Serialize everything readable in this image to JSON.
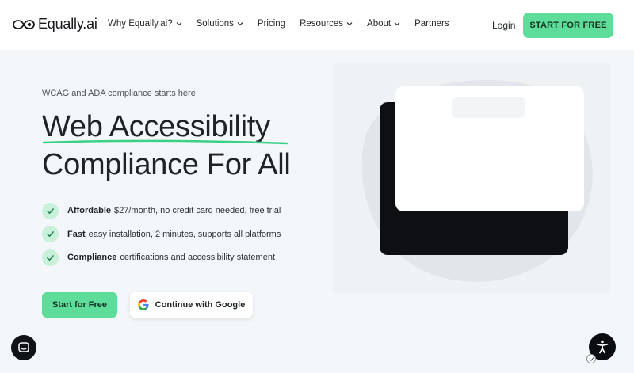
{
  "header": {
    "brand": "Equally.ai",
    "nav": [
      {
        "label": "Why Equally.ai?",
        "has_dropdown": true
      },
      {
        "label": "Solutions",
        "has_dropdown": true
      },
      {
        "label": "Pricing",
        "has_dropdown": false
      },
      {
        "label": "Resources",
        "has_dropdown": true
      },
      {
        "label": "About",
        "has_dropdown": true
      },
      {
        "label": "Partners",
        "has_dropdown": false
      }
    ],
    "login_label": "Login",
    "cta_label": "START FOR FREE"
  },
  "hero": {
    "eyebrow": "WCAG and ADA compliance starts here",
    "title_line1": "Web Accessibility",
    "title_line2": "Compliance For All",
    "features": [
      {
        "bold": "Affordable",
        "text": "$27/month, no credit card needed, free trial"
      },
      {
        "bold": "Fast",
        "text": "easy installation, 2 minutes, supports all platforms"
      },
      {
        "bold": "Compliance",
        "text": "certifications and accessibility statement"
      }
    ],
    "primary_button": "Start for Free",
    "google_button": "Continue with Google"
  },
  "icons": {
    "logo": "infinity-eye-logo-icon",
    "chevron": "chevron-down-icon",
    "check": "check-icon",
    "google": "google-g-icon",
    "chat": "chat-bubble-icon",
    "accessibility": "accessibility-person-icon"
  },
  "colors": {
    "accent_green": "#5ddc9a",
    "check_bg": "#c9f0db",
    "hero_bg": "#f4f7fa",
    "dark": "#0f1216"
  }
}
